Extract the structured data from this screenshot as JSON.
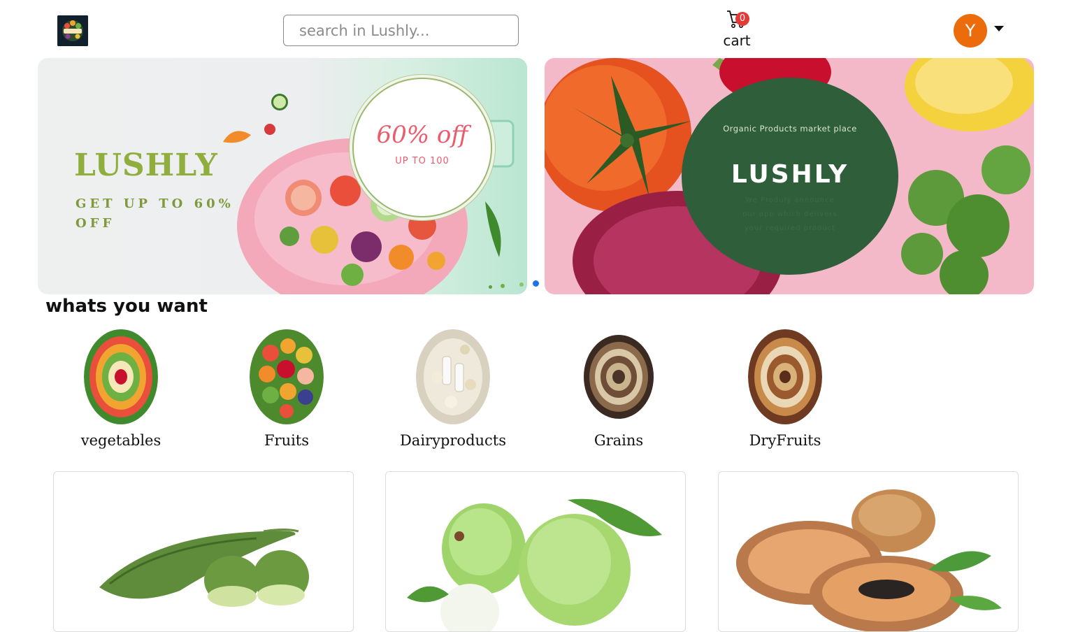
{
  "header": {
    "logo_text": "LUSHLY",
    "search_placeholder": "search in Lushly...",
    "cart_label": "cart",
    "cart_count": "0",
    "avatar_initial": "Y"
  },
  "banners": [
    {
      "title": "LUSHLY",
      "subtitle": "GET UP TO 60% OFF",
      "offer": "60% off",
      "offer_sub": "UP TO 100"
    },
    {
      "tagline": "Organic Products market place",
      "title": "LUSHLY",
      "description": "We Produly announce our app which delivers your required product"
    }
  ],
  "section_title": "whats you want",
  "categories": [
    {
      "label": "vegetables",
      "icon": "vegetables-image"
    },
    {
      "label": "Fruits",
      "icon": "fruits-image"
    },
    {
      "label": "Dairyproducts",
      "icon": "dairy-image"
    },
    {
      "label": "Grains",
      "icon": "grains-image"
    },
    {
      "label": "DryFruits",
      "icon": "dryfruits-image"
    }
  ],
  "products": [
    {
      "icon": "ridge-gourd-image"
    },
    {
      "icon": "guava-image"
    },
    {
      "icon": "sapota-image"
    }
  ],
  "colors": {
    "accent": "#ec6c0c",
    "badge": "#e53935",
    "carousel_active": "#1a73e8",
    "banner_green": "#2f5e3a"
  }
}
